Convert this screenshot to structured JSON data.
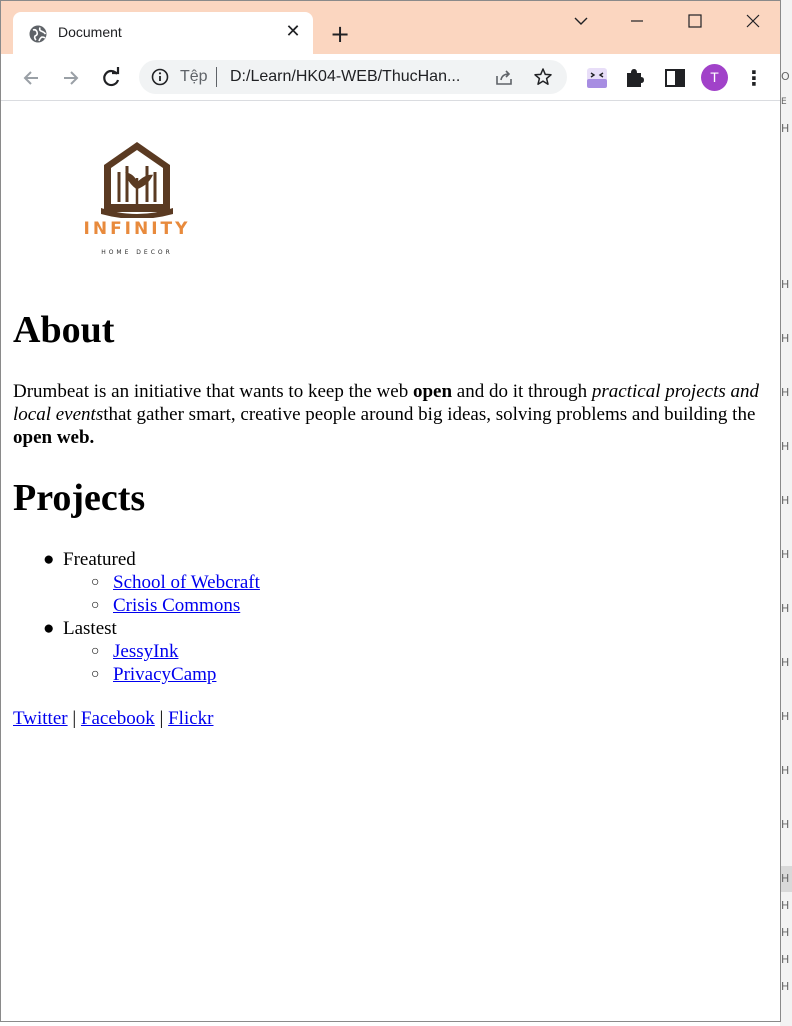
{
  "browser": {
    "tab_title": "Document",
    "address_scheme": "Tệp",
    "address_url": "D:/Learn/HK04-WEB/ThucHan...",
    "avatar_letter": "T",
    "theme_color": "#fbd6c0",
    "avatar_color": "#a142c9",
    "icons": [
      "globe-icon",
      "close-icon",
      "plus-icon",
      "chevron-down-icon",
      "minimize-icon",
      "maximize-icon",
      "close-window-icon",
      "back-arrow-icon",
      "forward-arrow-icon",
      "reload-icon",
      "info-icon",
      "share-icon",
      "star-icon",
      "extension-face-icon",
      "puzzle-icon",
      "side-panel-icon",
      "kebab-menu-icon"
    ]
  },
  "page": {
    "logo": {
      "brand": "INFINITY",
      "tagline": "HOME DECOR",
      "brand_color": "#e88a3c",
      "house_color": "#5a3a22"
    },
    "about": {
      "heading": "About",
      "p1": "Drumbeat is an initiative that wants to keep the web ",
      "p_bold1": "open",
      "p2": " and do it through ",
      "p_italic": "practical projects and local events",
      "p3": "that gather smart, creative people around big ideas, solving problems and building the ",
      "p_bold2": "open web."
    },
    "projects": {
      "heading": "Projects",
      "groups": [
        {
          "label": "Freatured",
          "links": [
            "School of Webcraft",
            "Crisis Commons"
          ]
        },
        {
          "label": "Lastest",
          "links": [
            "JessyInk",
            "PrivacyCamp"
          ]
        }
      ]
    },
    "social": {
      "links": [
        "Twitter",
        "Facebook",
        "Flickr"
      ],
      "separator": "|"
    },
    "link_color": "#0000ee"
  },
  "background_window": {
    "lines": [
      "O",
      "E",
      "H",
      "H",
      "H",
      "H",
      "H",
      "H",
      "H",
      "H",
      "H",
      "H",
      "H",
      "H",
      "H",
      "H",
      "H",
      "H",
      "H",
      "H"
    ]
  }
}
